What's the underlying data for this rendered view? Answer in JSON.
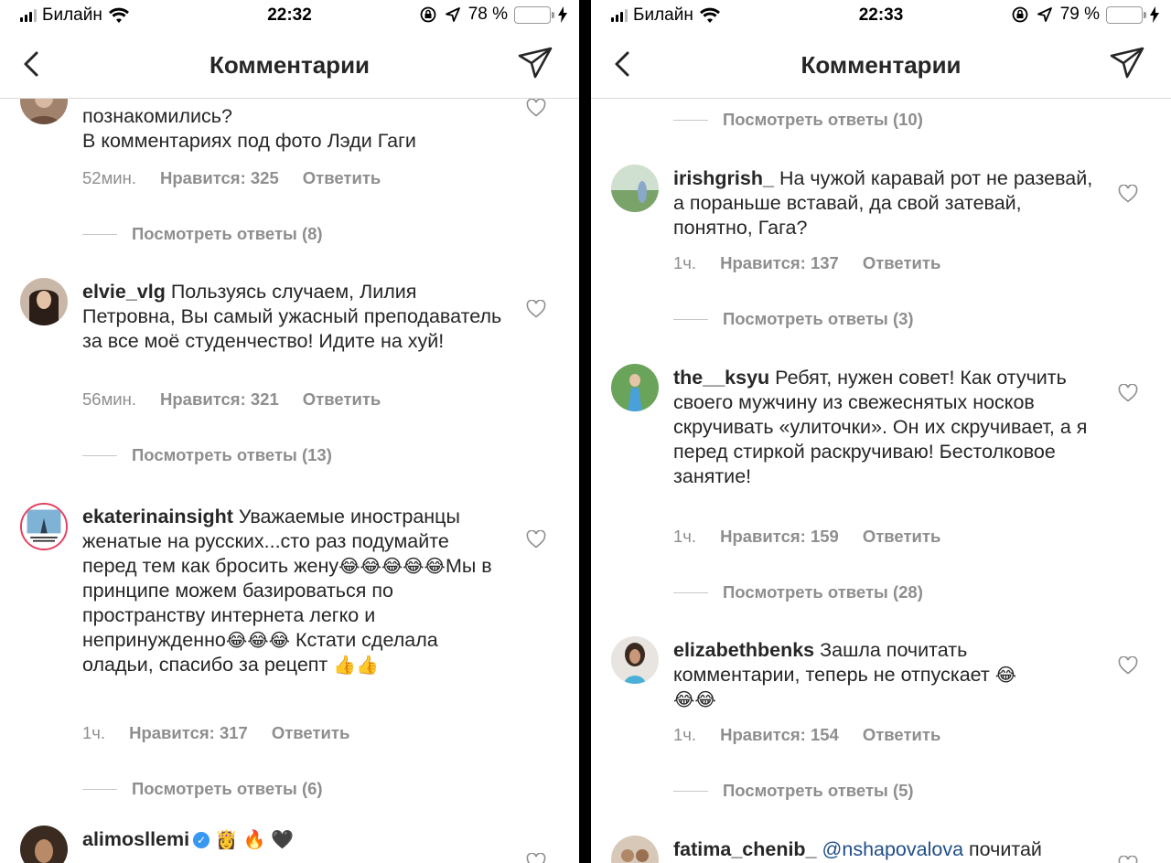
{
  "left": {
    "status": {
      "carrier": "Билайн",
      "time": "22:32",
      "battery": "78 %",
      "battery_level": 0.78
    },
    "nav": {
      "title": "Комментарии"
    },
    "top_comment": {
      "text_line1": "познакомились?",
      "text_line2": "В комментариях под фото Лэди Гаги",
      "time": "52мин.",
      "likes": "Нравится: 325",
      "reply": "Ответить",
      "view_replies": "Посмотреть ответы (8)"
    },
    "c1": {
      "user": "elvie_vlg",
      "text": "Пользуясь случаем, Лилия Петровна, Вы самый ужасный преподаватель за все моё студенчество! Идите на хуй!",
      "time": "56мин.",
      "likes": "Нравится: 321",
      "reply": "Ответить",
      "view_replies": "Посмотреть ответы (13)"
    },
    "c2": {
      "user": "ekaterinainsight",
      "text_a": "Уважаемые иностранцы женатые на русских...сто раз подумайте перед тем как бросить жену",
      "text_b": "Мы в принципе можем базироваться по пространству интернета легко и непринужденно",
      "text_c": " Кстати сделала оладьи, спасибо за рецепт ",
      "time": "1ч.",
      "likes": "Нравится: 317",
      "reply": "Ответить",
      "view_replies": "Посмотреть ответы (6)"
    },
    "c3": {
      "user": "alimosllemi",
      "emojis": "👸 🔥 🖤"
    }
  },
  "right": {
    "status": {
      "carrier": "Билайн",
      "time": "22:33",
      "battery": "79 %",
      "battery_level": 0.79
    },
    "nav": {
      "title": "Комментарии"
    },
    "top_replies": "Посмотреть ответы (10)",
    "c1": {
      "user": "irishgrish_",
      "text": "На чужой каравай рот не разевай, а пораньше вставай, да свой затевай, понятно, Гага?",
      "time": "1ч.",
      "likes": "Нравится: 137",
      "reply": "Ответить",
      "view_replies": "Посмотреть ответы (3)"
    },
    "c2": {
      "user": "the__ksyu",
      "text": "Ребят, нужен совет! Как отучить своего мужчину из свежеснятых носков скручивать «улиточки». Он их скручивает, а я перед стиркой раскручиваю! Бестолковое занятие!",
      "time": "1ч.",
      "likes": "Нравится: 159",
      "reply": "Ответить",
      "view_replies": "Посмотреть ответы (28)"
    },
    "c3": {
      "user": "elizabethbenks",
      "text": "Зашла почитать комментарии, теперь не отпускает ",
      "time": "1ч.",
      "likes": "Нравится: 154",
      "reply": "Ответить",
      "view_replies": "Посмотреть ответы (5)"
    },
    "c4": {
      "user": "fatima_chenib_",
      "mention": "@nshapovalova",
      "text": "почитай"
    }
  },
  "colors": {
    "text": "#262626",
    "muted": "#8e8e8e",
    "battery": "#f5c400",
    "mention": "#1f4d8a"
  },
  "icons": [
    "back-chevron-icon",
    "send-icon",
    "heart-icon",
    "wifi-icon",
    "location-arrow-icon",
    "orientation-lock-icon",
    "verified-badge-icon"
  ]
}
